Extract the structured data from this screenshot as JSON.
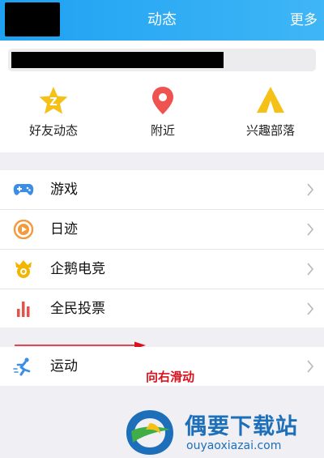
{
  "header": {
    "title": "动态",
    "more_label": "更多"
  },
  "quick_links": [
    {
      "label": "好友动态",
      "icon": "star-q-icon",
      "color": "#f5c116"
    },
    {
      "label": "附近",
      "icon": "location-pin-icon",
      "color": "#ef5350"
    },
    {
      "label": "兴趣部落",
      "icon": "tent-icon",
      "color": "#f5c116"
    }
  ],
  "list": [
    {
      "label": "游戏",
      "icon": "gamepad-icon",
      "color": "#3b8ee8"
    },
    {
      "label": "日迹",
      "icon": "play-circle-icon",
      "color": "#f39a3c"
    },
    {
      "label": "企鹅电竞",
      "icon": "esports-badge-icon",
      "color": "#f4b400"
    },
    {
      "label": "全民投票",
      "icon": "bar-chart-icon",
      "color": "#e5524c"
    }
  ],
  "list2": [
    {
      "label": "运动",
      "icon": "running-icon",
      "color": "#3b8ee8"
    }
  ],
  "annotation": {
    "text": "向右滑动",
    "color": "#d9111c"
  },
  "watermark": {
    "title": "偶要下载站",
    "url": "ouyaoxiazai.com"
  },
  "colors": {
    "header": "#1ea1f2",
    "background": "#efeff4"
  }
}
